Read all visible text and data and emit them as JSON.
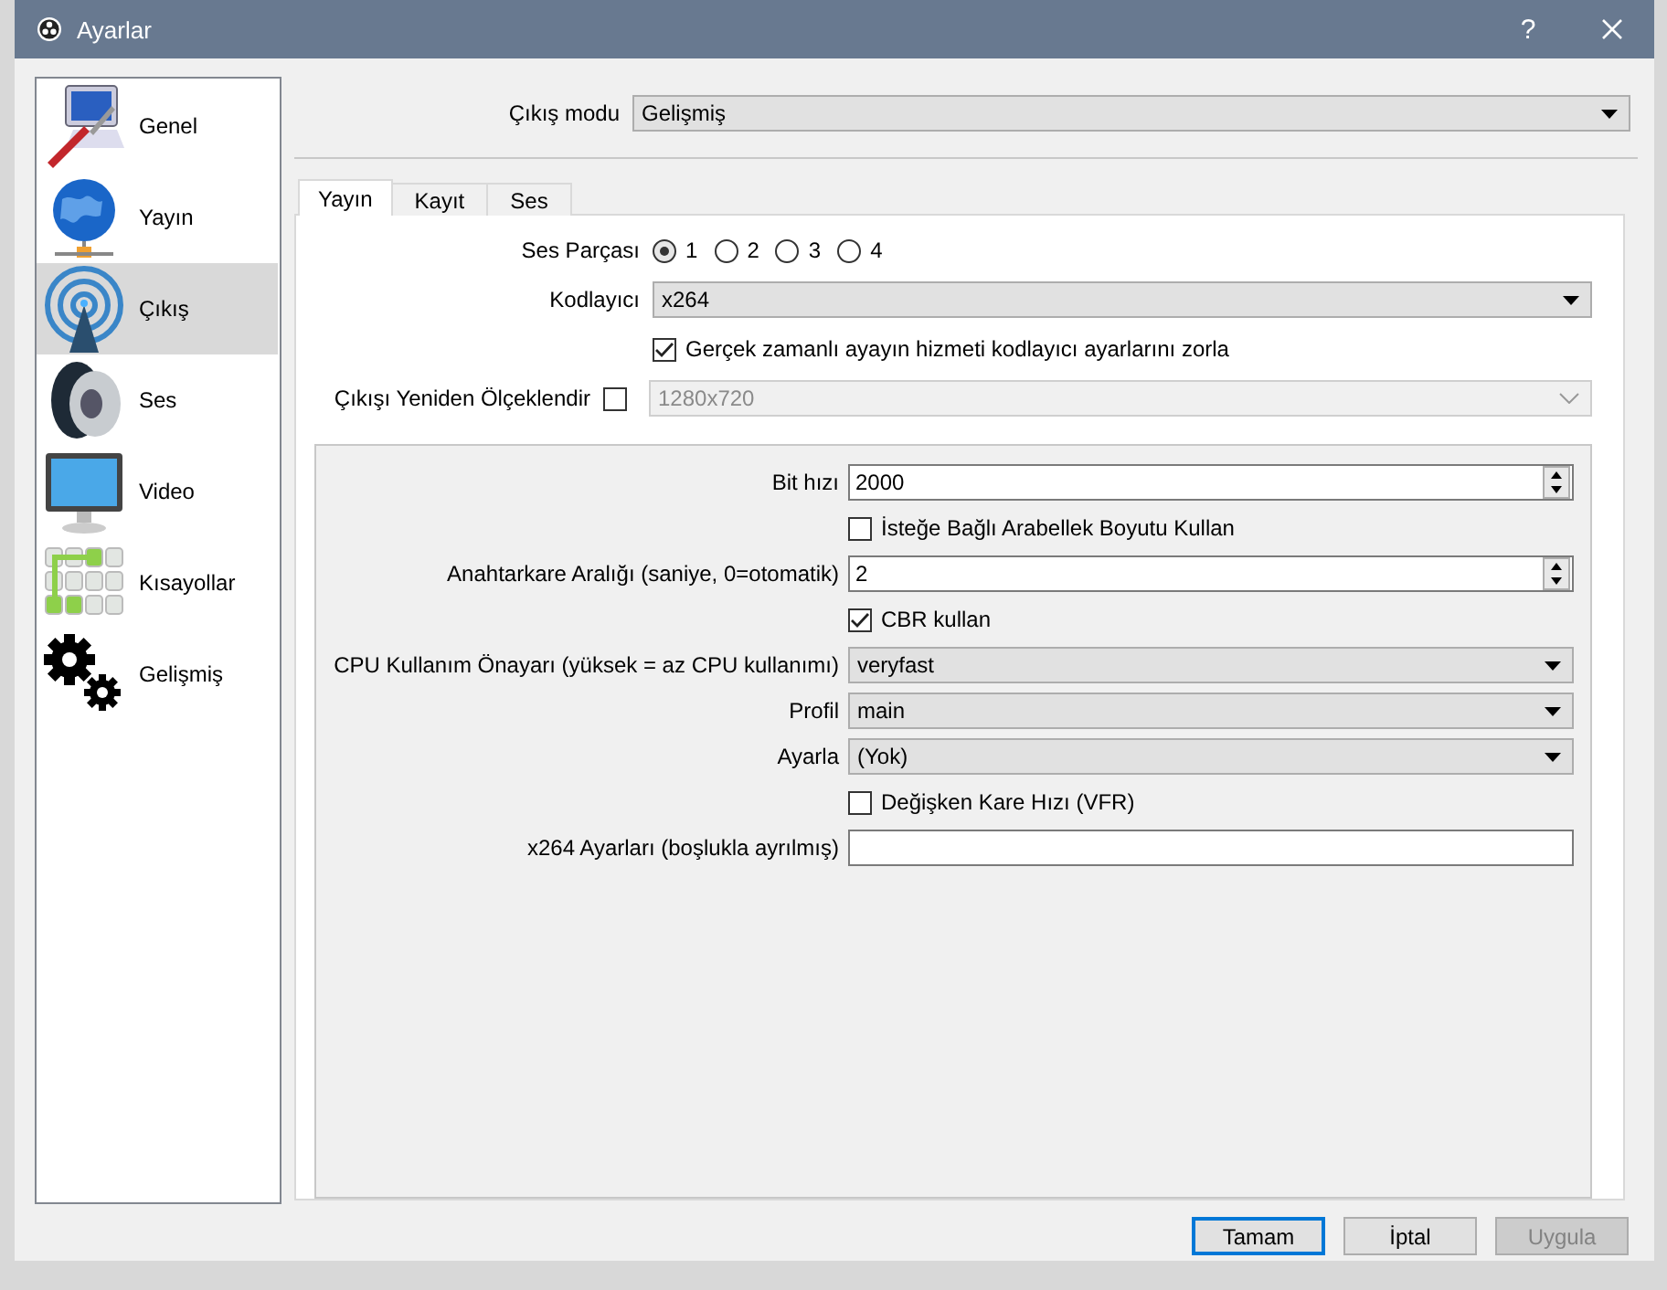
{
  "window": {
    "title": "Ayarlar",
    "help": "?"
  },
  "sidebar": {
    "items": [
      {
        "label": "Genel",
        "selected": false
      },
      {
        "label": "Yayın",
        "selected": false
      },
      {
        "label": "Çıkış",
        "selected": true
      },
      {
        "label": "Ses",
        "selected": false
      },
      {
        "label": "Video",
        "selected": false
      },
      {
        "label": "Kısayollar",
        "selected": false
      },
      {
        "label": "Gelişmiş",
        "selected": false
      }
    ]
  },
  "output_mode": {
    "label": "Çıkış modu",
    "value": "Gelişmiş"
  },
  "tabs": [
    {
      "label": "Yayın",
      "selected": true
    },
    {
      "label": "Kayıt",
      "selected": false
    },
    {
      "label": "Ses",
      "selected": false
    }
  ],
  "audio_track": {
    "label": "Ses Parçası",
    "options": [
      {
        "label": "1",
        "selected": true
      },
      {
        "label": "2",
        "selected": false
      },
      {
        "label": "3",
        "selected": false
      },
      {
        "label": "4",
        "selected": false
      }
    ]
  },
  "encoder": {
    "label": "Kodlayıcı",
    "value": "x264"
  },
  "enforce": {
    "label": "Gerçek zamanlı ayayın hizmeti kodlayıcı ayarlarını zorla",
    "checked": true
  },
  "rescale": {
    "label": "Çıkışı Yeniden Ölçeklendir",
    "checked": false,
    "value": "1280x720",
    "disabled": true
  },
  "encoder_settings": [
    {
      "kind": "spin",
      "label": "Bit hızı",
      "value": "2000"
    },
    {
      "kind": "checkbox",
      "label": "İsteğe Bağlı Arabellek Boyutu Kullan",
      "checked": false
    },
    {
      "kind": "spin",
      "label": "Anahtarkare Aralığı (saniye, 0=otomatik)",
      "value": "2"
    },
    {
      "kind": "checkbox",
      "label": "CBR kullan",
      "checked": true
    },
    {
      "kind": "select",
      "label": "CPU Kullanım Önayarı (yüksek = az CPU kullanımı)",
      "value": "veryfast"
    },
    {
      "kind": "select",
      "label": "Profil",
      "value": "main"
    },
    {
      "kind": "select",
      "label": "Ayarla",
      "value": "(Yok)"
    },
    {
      "kind": "checkbox",
      "label": "Değişken Kare Hızı (VFR)",
      "checked": false
    },
    {
      "kind": "text",
      "label": "x264 Ayarları (boşlukla ayrılmış)"
    }
  ],
  "buttons": [
    {
      "label": "Tamam",
      "kind": "default",
      "disabled": false
    },
    {
      "label": "İptal",
      "kind": "normal",
      "disabled": false
    },
    {
      "label": "Uygula",
      "kind": "normal",
      "disabled": true
    }
  ]
}
